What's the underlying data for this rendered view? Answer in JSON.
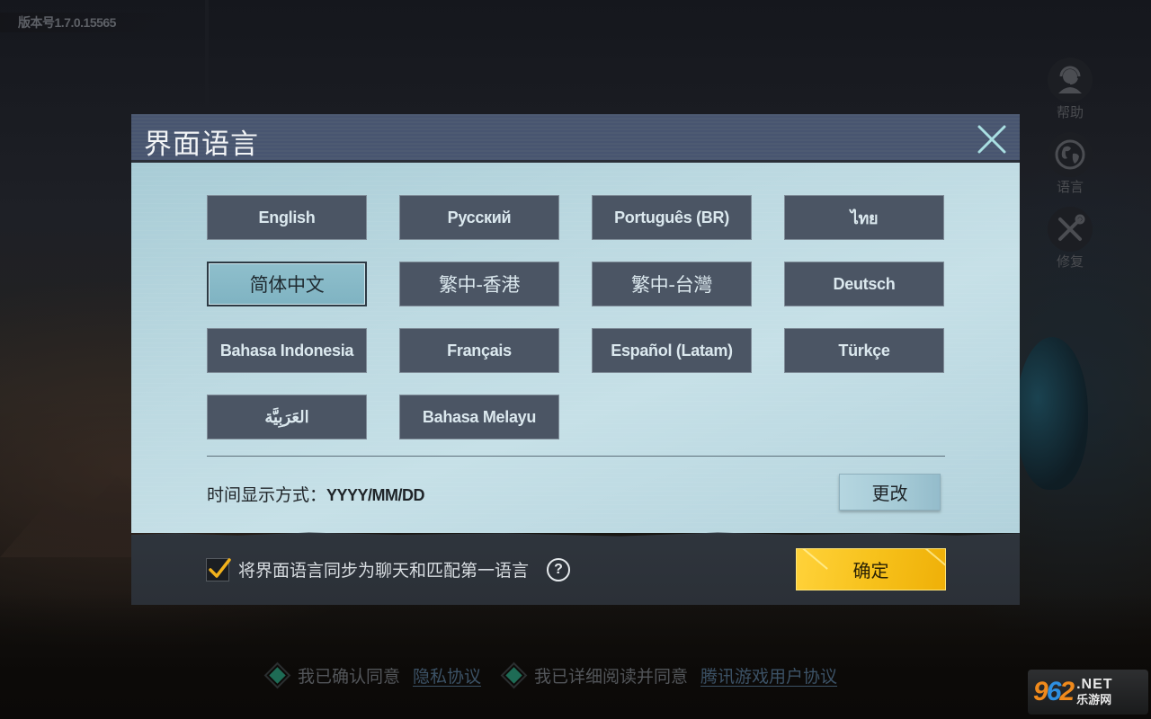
{
  "version": "版本号1.7.0.15565",
  "side_menu": [
    {
      "icon": "headset-icon",
      "label": "帮助"
    },
    {
      "icon": "globe-icon",
      "label": "语言"
    },
    {
      "icon": "wrench-screwdriver-icon",
      "label": "修复"
    }
  ],
  "dialog": {
    "title": "界面语言",
    "close_icon": "close-icon",
    "languages": [
      {
        "label": "English",
        "selected": false
      },
      {
        "label": "Русский",
        "selected": false
      },
      {
        "label": "Português (BR)",
        "selected": false
      },
      {
        "label": "ไทย",
        "selected": false
      },
      {
        "label": "简体中文",
        "selected": true
      },
      {
        "label": "繁中-香港",
        "selected": false
      },
      {
        "label": "繁中-台灣",
        "selected": false
      },
      {
        "label": "Deutsch",
        "selected": false
      },
      {
        "label": "Bahasa Indonesia",
        "selected": false
      },
      {
        "label": "Français",
        "selected": false
      },
      {
        "label": "Español (Latam)",
        "selected": false
      },
      {
        "label": "Türkçe",
        "selected": false
      },
      {
        "label": "العَرَبِيَّة",
        "selected": false
      },
      {
        "label": "Bahasa Melayu",
        "selected": false
      }
    ],
    "time_format_label": "时间显示方式：",
    "time_format_value": "YYYY/MM/DD",
    "change_button": "更改",
    "sync_checkbox": {
      "checked": true,
      "label": "将界面语言同步为聊天和匹配第一语言"
    },
    "help_icon": "?",
    "confirm_button": "确定"
  },
  "agreements": [
    {
      "text": "我已确认同意",
      "link": "隐私协议"
    },
    {
      "text": "我已详细阅读并同意",
      "link": "腾讯游戏用户协议"
    }
  ],
  "watermark": {
    "number_a": "9",
    "number_b": "6",
    "number_c": "2",
    "suffix": ".NET",
    "subtitle": "乐游网"
  },
  "colors": {
    "accent_yellow": "#f7c21c",
    "selected_lang": "#8fbfcc",
    "lang_button": "#4b5564",
    "agree_diamond": "#1e6b55"
  }
}
